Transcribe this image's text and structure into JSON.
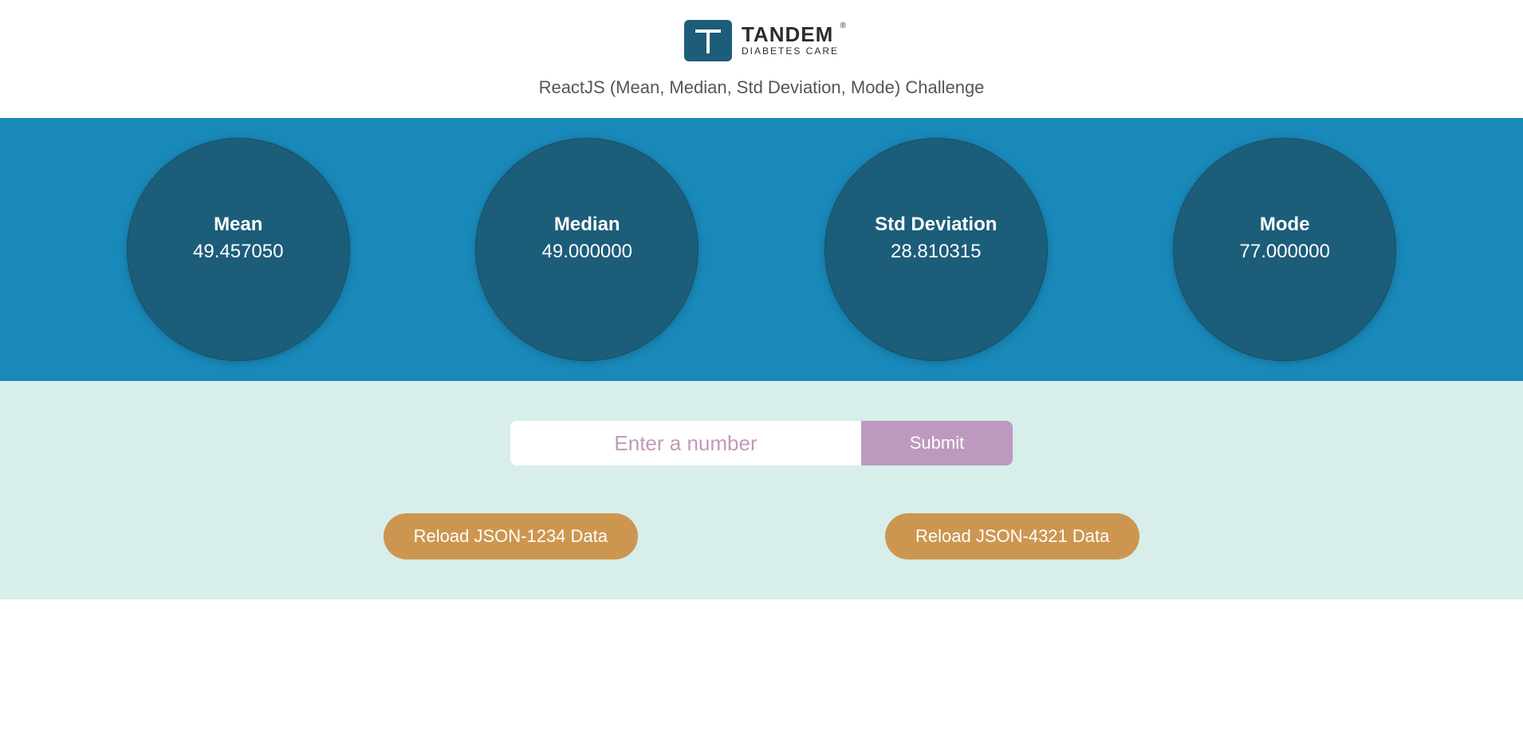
{
  "header": {
    "brand": "TANDEM",
    "brand_sub": "DIABETES CARE",
    "subtitle": "ReactJS (Mean, Median, Std Deviation, Mode) Challenge"
  },
  "stats": [
    {
      "label": "Mean",
      "value": "49.457050"
    },
    {
      "label": "Median",
      "value": "49.000000"
    },
    {
      "label": "Std Deviation",
      "value": "28.810315"
    },
    {
      "label": "Mode",
      "value": "77.000000"
    }
  ],
  "controls": {
    "input_placeholder": "Enter a number",
    "submit_label": "Submit",
    "reload_1234_label": "Reload JSON-1234 Data",
    "reload_4321_label": "Reload JSON-4321 Data"
  }
}
